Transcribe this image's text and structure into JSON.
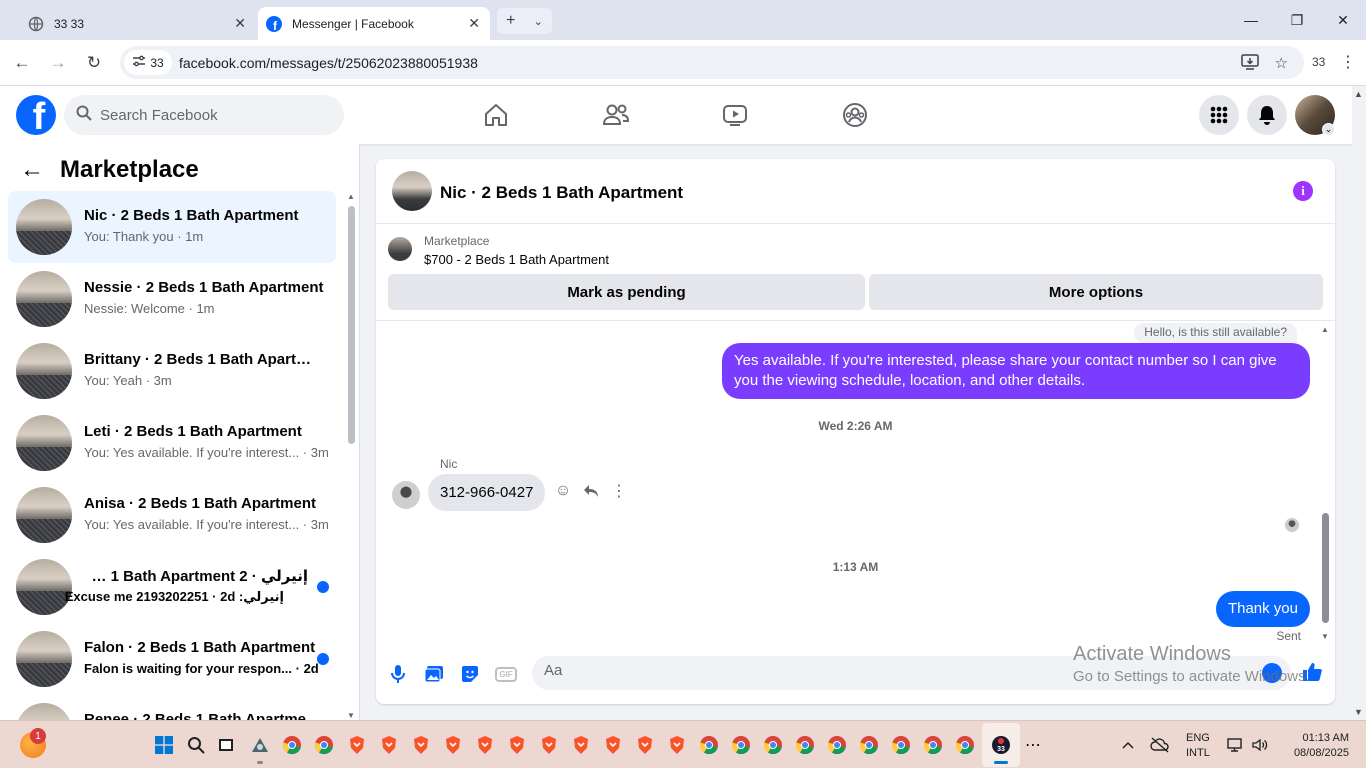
{
  "browser": {
    "tabs": [
      {
        "title": "33 33",
        "active": false
      },
      {
        "title": "Messenger | Facebook",
        "active": true
      }
    ],
    "site_chip": "33",
    "url": "facebook.com/messages/t/25062023880051938",
    "profile_label": "33"
  },
  "fb": {
    "search_placeholder": "Search Facebook"
  },
  "sidebar": {
    "title": "Marketplace",
    "threads": [
      {
        "name": "Nic · 2 Beds 1 Bath Apartment",
        "snippet": "You: Thank you · 1m",
        "selected": true,
        "unread": false
      },
      {
        "name": "Nessie · 2 Beds 1 Bath Apartment",
        "snippet": "Nessie: Welcome · 1m",
        "selected": false,
        "unread": false
      },
      {
        "name": "Brittany · 2 Beds 1 Bath Apartme...",
        "snippet": "You: Yeah · 3m",
        "selected": false,
        "unread": false
      },
      {
        "name": "Leti · 2 Beds 1 Bath Apartment",
        "snippet": "You: Yes available. If you're interest... · 3m",
        "selected": false,
        "unread": false
      },
      {
        "name": "Anisa · 2 Beds 1 Bath Apartment",
        "snippet": "You: Yes available. If you're interest... · 3m",
        "selected": false,
        "unread": false
      },
      {
        "name": "إنيرلي · 2 Beds 1 Bath Apartment",
        "snippet": "إنيرلي: Excuse me 2193202251 · 2d",
        "selected": false,
        "unread": true
      },
      {
        "name": "Falon · 2 Beds 1 Bath Apartment",
        "snippet": "Falon is waiting for your respon... · 2d",
        "selected": false,
        "unread": true
      },
      {
        "name": "Renee · 2 Beds 1 Bath Apartme...",
        "snippet": "",
        "selected": false,
        "unread": false
      }
    ]
  },
  "conversation": {
    "title": "Nic · 2 Beds 1 Bath Apartment",
    "marketplace_label": "Marketplace",
    "listing": "$700 - 2 Beds 1 Bath Apartment",
    "mark_pending": "Mark as pending",
    "more_options": "More options",
    "quoted": "Hello, is this still available?",
    "outgoing_1": "Yes available. If you're interested, please share your contact number so I can give you the viewing schedule, location, and other details.",
    "time_1": "Wed 2:26 AM",
    "sender": "Nic",
    "incoming_1": "312-966-0427",
    "time_2": "1:13 AM",
    "outgoing_2": "Thank you",
    "status": "Sent",
    "composer_placeholder": "Aa",
    "gif_label": "GIF"
  },
  "watermark": {
    "line1": "Activate Windows",
    "line2": "Go to Settings to activate Windows."
  },
  "taskbar": {
    "notification_count": "1",
    "lang_1": "ENG",
    "lang_2": "INTL",
    "time": "01:13 AM",
    "date": "08/08/2025",
    "active_app_label": "33"
  },
  "colors": {
    "fb_blue": "#0866ff",
    "outgoing_purple": "#7a3dff",
    "info_purple": "#a033ff"
  }
}
